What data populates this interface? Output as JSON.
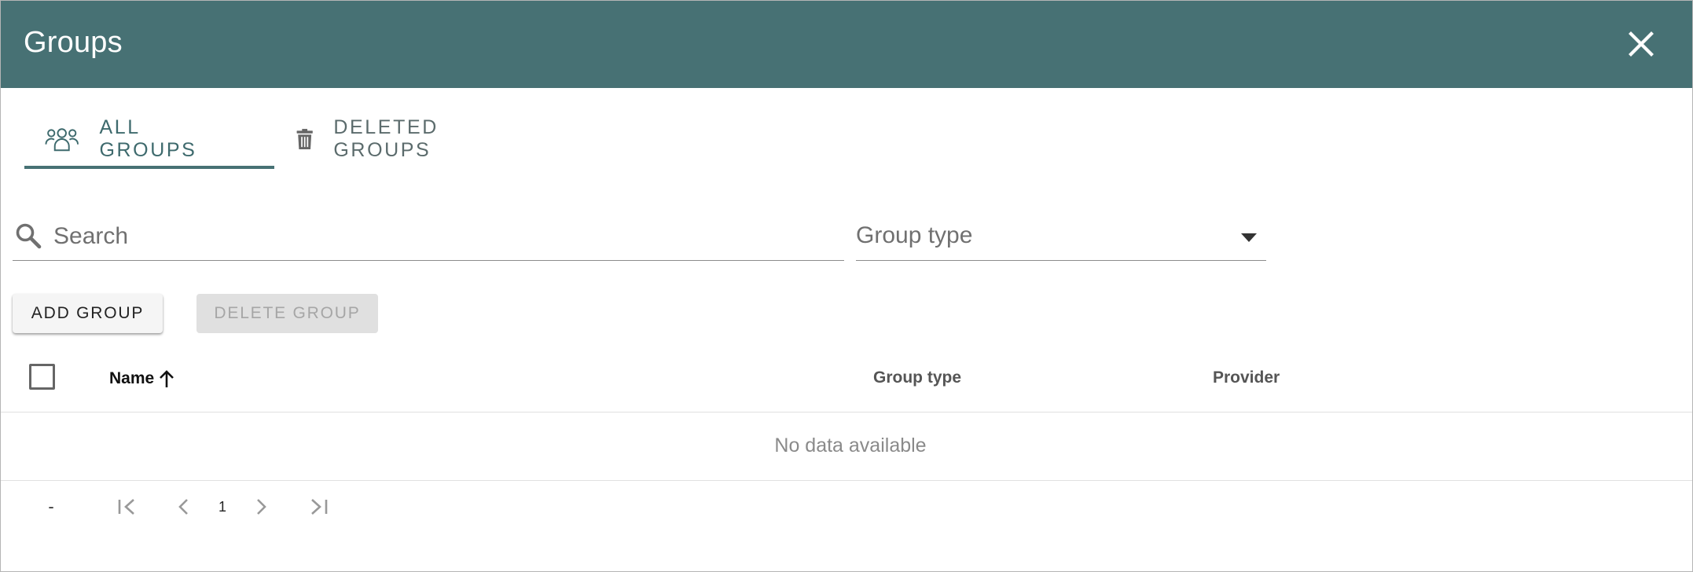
{
  "dialog": {
    "title": "Groups"
  },
  "tabs": [
    {
      "label": "ALL GROUPS",
      "icon": "people-group-icon",
      "active": true
    },
    {
      "label": "DELETED GROUPS",
      "icon": "trash-icon",
      "active": false
    }
  ],
  "filters": {
    "search_placeholder": "Search",
    "search_value": "",
    "group_type_label": "Group type"
  },
  "actions": {
    "add_label": "ADD GROUP",
    "delete_label": "DELETE GROUP"
  },
  "table": {
    "columns": [
      "Name",
      "Group type",
      "Provider"
    ],
    "sort_column": "Name",
    "sort_direction": "ascending",
    "rows": [],
    "empty_text": "No data available"
  },
  "pagination": {
    "range_text": "-",
    "current_page": "1"
  },
  "colors": {
    "header_bg": "#477174",
    "accent": "#477174"
  }
}
